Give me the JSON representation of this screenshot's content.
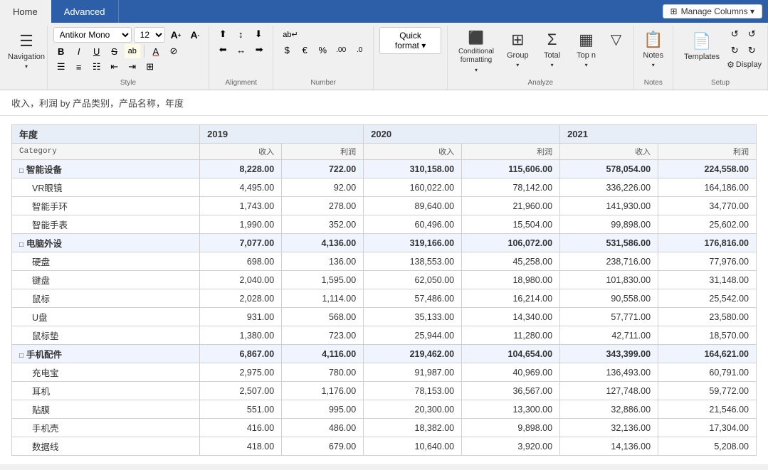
{
  "tabs": [
    {
      "label": "Home",
      "active": true
    },
    {
      "label": "Advanced",
      "active": false
    }
  ],
  "manage_columns_btn": "Manage Columns ▾",
  "ribbon": {
    "navigation": {
      "label": "Navigation",
      "icon": "≡",
      "arrow": "▾"
    },
    "style_group": {
      "label": "Style",
      "font_name": "Antikor Mono",
      "font_size": "12",
      "font_size_inc": "A↑",
      "font_size_dec": "A↓",
      "bold": "B",
      "italic": "I",
      "underline": "U",
      "strikethrough": "S",
      "text_color": "A",
      "highlight": "ab",
      "format_btns": [
        "≡",
        "≡",
        "≡",
        "≡",
        "≡",
        "≡"
      ]
    },
    "alignment_group": {
      "label": "Alignment",
      "btns": [
        "←",
        "↔",
        "→",
        "↑",
        "↕",
        "↓"
      ]
    },
    "number_group": {
      "label": "Number",
      "wrap_btn": "ab↵",
      "format_btns": [
        "$",
        "€",
        "%",
        ".00",
        ".0"
      ]
    },
    "quick_format": {
      "label": "Quick format ▾"
    },
    "conditional_formatting": {
      "label": "Conditional\nformatting ▾",
      "icon": "⬛"
    },
    "group_btn": {
      "label": "Group",
      "icon": "⊞",
      "arrow": "▾"
    },
    "total_btn": {
      "label": "Total",
      "icon": "Σ",
      "arrow": "▾"
    },
    "top_n_btn": {
      "label": "Top n",
      "icon": "▦",
      "arrow": "▾"
    },
    "filter_btn": {
      "icon": "▽"
    },
    "analyze_label": "Analyze",
    "notes": {
      "label": "Notes",
      "icon": "📋",
      "arrow": "▾"
    },
    "notes_label": "Notes",
    "templates": {
      "label": "Templates",
      "icon": "📄"
    },
    "display": {
      "label": "Display",
      "icon": "⊙"
    },
    "setup_label": "Setup",
    "undo_btns": [
      "↺",
      "↻",
      "↺",
      "↻"
    ]
  },
  "breadcrumb": "收入，利润 by 产品类别，产品名称，年度",
  "table": {
    "year_header_label": "年度",
    "years": [
      "2019",
      "2020",
      "2021"
    ],
    "col_headers": [
      "收入",
      "利润",
      "收入",
      "利润",
      "收入",
      "利润"
    ],
    "category_col": "Category",
    "groups": [
      {
        "name": "智能设备",
        "values": [
          "8,228.00",
          "722.00",
          "310,158.00",
          "115,606.00",
          "578,054.00",
          "224,558.00"
        ],
        "children": [
          {
            "name": "VR眼镜",
            "values": [
              "4,495.00",
              "92.00",
              "160,022.00",
              "78,142.00",
              "336,226.00",
              "164,186.00"
            ]
          },
          {
            "name": "智能手环",
            "values": [
              "1,743.00",
              "278.00",
              "89,640.00",
              "21,960.00",
              "141,930.00",
              "34,770.00"
            ]
          },
          {
            "name": "智能手表",
            "values": [
              "1,990.00",
              "352.00",
              "60,496.00",
              "15,504.00",
              "99,898.00",
              "25,602.00"
            ]
          }
        ]
      },
      {
        "name": "电脑外设",
        "values": [
          "7,077.00",
          "4,136.00",
          "319,166.00",
          "106,072.00",
          "531,586.00",
          "176,816.00"
        ],
        "children": [
          {
            "name": "硬盘",
            "values": [
              "698.00",
              "136.00",
              "138,553.00",
              "45,258.00",
              "238,716.00",
              "77,976.00"
            ]
          },
          {
            "name": "键盘",
            "values": [
              "2,040.00",
              "1,595.00",
              "62,050.00",
              "18,980.00",
              "101,830.00",
              "31,148.00"
            ]
          },
          {
            "name": "鼠标",
            "values": [
              "2,028.00",
              "1,114.00",
              "57,486.00",
              "16,214.00",
              "90,558.00",
              "25,542.00"
            ]
          },
          {
            "name": "U盘",
            "values": [
              "931.00",
              "568.00",
              "35,133.00",
              "14,340.00",
              "57,771.00",
              "23,580.00"
            ]
          },
          {
            "name": "鼠标垫",
            "values": [
              "1,380.00",
              "723.00",
              "25,944.00",
              "11,280.00",
              "42,711.00",
              "18,570.00"
            ]
          }
        ]
      },
      {
        "name": "手机配件",
        "values": [
          "6,867.00",
          "4,116.00",
          "219,462.00",
          "104,654.00",
          "343,399.00",
          "164,621.00"
        ],
        "children": [
          {
            "name": "充电宝",
            "values": [
              "2,975.00",
              "780.00",
              "91,987.00",
              "40,969.00",
              "136,493.00",
              "60,791.00"
            ]
          },
          {
            "name": "耳机",
            "values": [
              "2,507.00",
              "1,176.00",
              "78,153.00",
              "36,567.00",
              "127,748.00",
              "59,772.00"
            ]
          },
          {
            "name": "贴膜",
            "values": [
              "551.00",
              "995.00",
              "20,300.00",
              "13,300.00",
              "32,886.00",
              "21,546.00"
            ]
          },
          {
            "name": "手机壳",
            "values": [
              "416.00",
              "486.00",
              "18,382.00",
              "9,898.00",
              "32,136.00",
              "17,304.00"
            ]
          },
          {
            "name": "数据线",
            "values": [
              "418.00",
              "679.00",
              "10,640.00",
              "3,920.00",
              "14,136.00",
              "5,208.00"
            ]
          }
        ]
      }
    ]
  }
}
